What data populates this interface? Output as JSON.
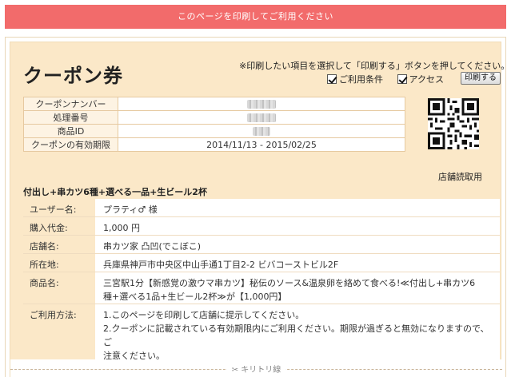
{
  "banner": "このページを印刷してご利用ください",
  "coupon": {
    "title": "クーポン券",
    "print_note": "※印刷したい項目を選択して「印刷する」ボタンを押してください。",
    "options": [
      {
        "label": "ご利用条件",
        "checked": true
      },
      {
        "label": "アクセス",
        "checked": true
      }
    ],
    "print_button": "印刷する",
    "info_rows": [
      {
        "label": "クーポンナンバー",
        "value": ""
      },
      {
        "label": "処理番号",
        "value": ""
      },
      {
        "label": "商品ID",
        "value": ""
      },
      {
        "label": "クーポンの有効期限",
        "value": "2014/11/13 - 2015/02/25"
      }
    ],
    "qr_caption": "店舗読取用",
    "product_title": "付出し+串カツ6種+選べる一品+生ビール2杯",
    "details": [
      {
        "label": "ユーザー名:",
        "lines": [
          "プラティ♂ 様"
        ]
      },
      {
        "label": "購入代金:",
        "lines": [
          "1,000 円"
        ]
      },
      {
        "label": "店舗名:",
        "lines": [
          "串カツ家 凸凹(でこぼこ)"
        ]
      },
      {
        "label": "所在地:",
        "lines": [
          "兵庫県神戸市中央区中山手通1丁目2-2 ビバコーストビル2F"
        ]
      },
      {
        "label": "商品名:",
        "lines": [
          "三宮駅1分【新感覚の激ウマ串カツ】秘伝のソース&温泉卵を絡めて食べる!≪付出し+串カツ6",
          "種+選べる1品+生ビール2杯≫が【1,000円】"
        ]
      },
      {
        "label": "ご利用方法:",
        "lines": [
          "1.このページを印刷して店舗に提示してください。",
          "2.クーポンに記載されている有効期限内にご利用ください。期限が過ぎると無効になりますので、ご",
          "注意ください。"
        ]
      }
    ],
    "cut_line": "キリトリ線"
  }
}
